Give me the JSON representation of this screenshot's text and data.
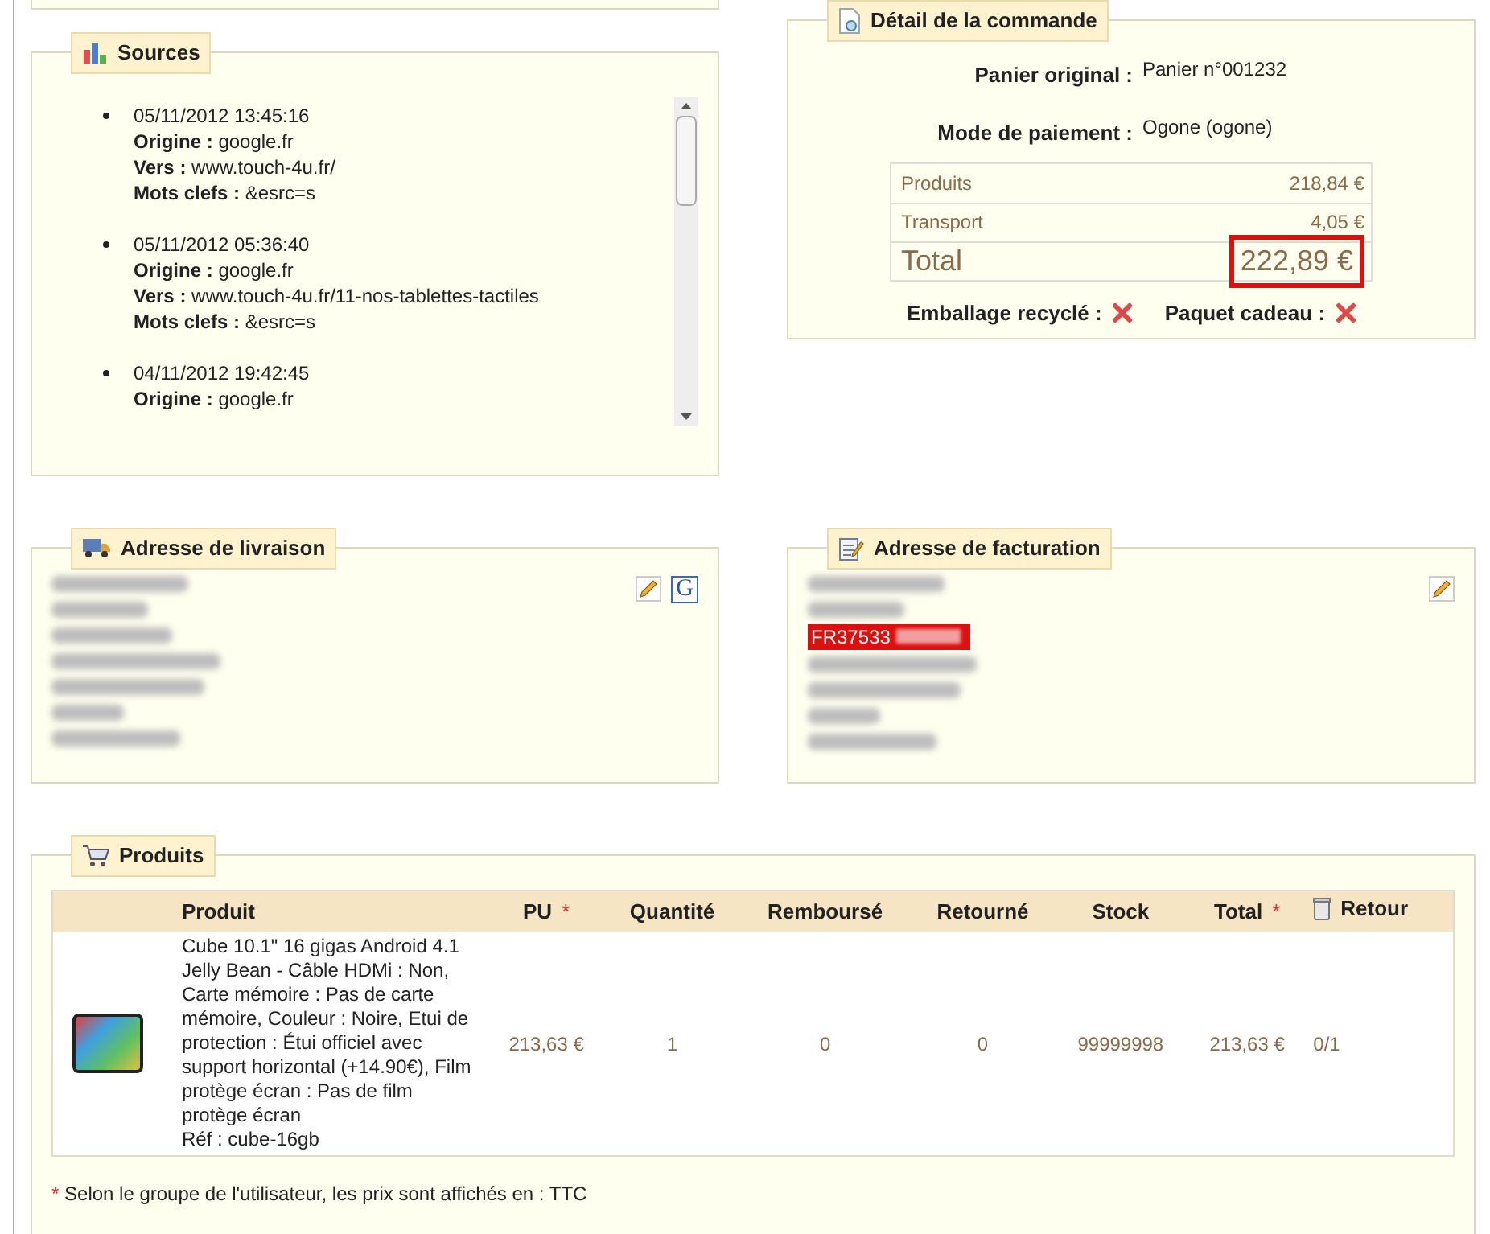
{
  "sources": {
    "title": "Sources",
    "entries": [
      {
        "date": "05/11/2012 13:45:16",
        "fields": [
          {
            "label": "Origine :",
            "value": "google.fr"
          },
          {
            "label": "Vers :",
            "value": "www.touch-4u.fr/"
          },
          {
            "label": "Mots clefs :",
            "value": "&esrc=s"
          }
        ]
      },
      {
        "date": "05/11/2012 05:36:40",
        "fields": [
          {
            "label": "Origine :",
            "value": "google.fr"
          },
          {
            "label": "Vers :",
            "value": "www.touch-4u.fr/11-nos-tablettes-tactiles"
          },
          {
            "label": "Mots clefs :",
            "value": "&esrc=s"
          }
        ]
      },
      {
        "date": "04/11/2012 19:42:45",
        "fields": [
          {
            "label": "Origine :",
            "value": "google.fr"
          }
        ]
      }
    ]
  },
  "order": {
    "title": "Détail de la commande",
    "info": [
      {
        "label": "Panier original :",
        "value": "Panier n°001232"
      },
      {
        "label": "Mode de paiement :",
        "value": "Ogone (ogone)"
      }
    ],
    "totals": [
      {
        "label": "Produits",
        "value": "218,84 €",
        "kind": "line",
        "highlighted": false
      },
      {
        "label": "Transport",
        "value": "4,05 €",
        "kind": "line",
        "highlighted": false
      },
      {
        "label": "Total",
        "value": "222,89 €",
        "kind": "total",
        "highlighted": true
      }
    ],
    "options": [
      {
        "label": "Emballage recyclé :",
        "checked": false
      },
      {
        "label": "Paquet cadeau :",
        "checked": false
      }
    ]
  },
  "shipping": {
    "title": "Adresse de livraison",
    "actions": [
      {
        "kind": "edit"
      },
      {
        "kind": "map",
        "label": "G"
      }
    ]
  },
  "billing": {
    "title": "Adresse de facturation",
    "visible_text": "FR37533",
    "actions": [
      {
        "kind": "edit"
      }
    ]
  },
  "products": {
    "title": "Produits",
    "columns": [
      {
        "label": "Produit",
        "starred": false,
        "icon": false
      },
      {
        "label": "PU",
        "starred": true,
        "icon": false
      },
      {
        "label": "Quantité",
        "starred": false,
        "icon": false
      },
      {
        "label": "Remboursé",
        "starred": false,
        "icon": false
      },
      {
        "label": "Retourné",
        "starred": false,
        "icon": false
      },
      {
        "label": "Stock",
        "starred": false,
        "icon": false
      },
      {
        "label": "Total",
        "starred": true,
        "icon": false
      },
      {
        "label": "Retour",
        "starred": false,
        "icon": true
      }
    ],
    "rows": [
      {
        "cells": [
          {
            "text": "Cube 10.1\" 16 gigas Android 4.1 Jelly Bean - Câble HDMi : Non, Carte mémoire : Pas de carte mémoire, Couleur : Noire, Etui de protection : Étui officiel avec support horizontal (+14.90€), Film protège écran : Pas de film protège écran",
            "reference": "Réf : cube-16gb"
          },
          {
            "text": "213,63 €"
          },
          {
            "text": "1"
          },
          {
            "text": "0"
          },
          {
            "text": "0"
          },
          {
            "text": "99999998"
          },
          {
            "text": "213,63 €"
          },
          {
            "text": "0/1"
          }
        ]
      }
    ],
    "note": {
      "mark": "*",
      "text": "Selon le groupe de l'utilisateur, les prix sont affichés en : TTC"
    }
  }
}
